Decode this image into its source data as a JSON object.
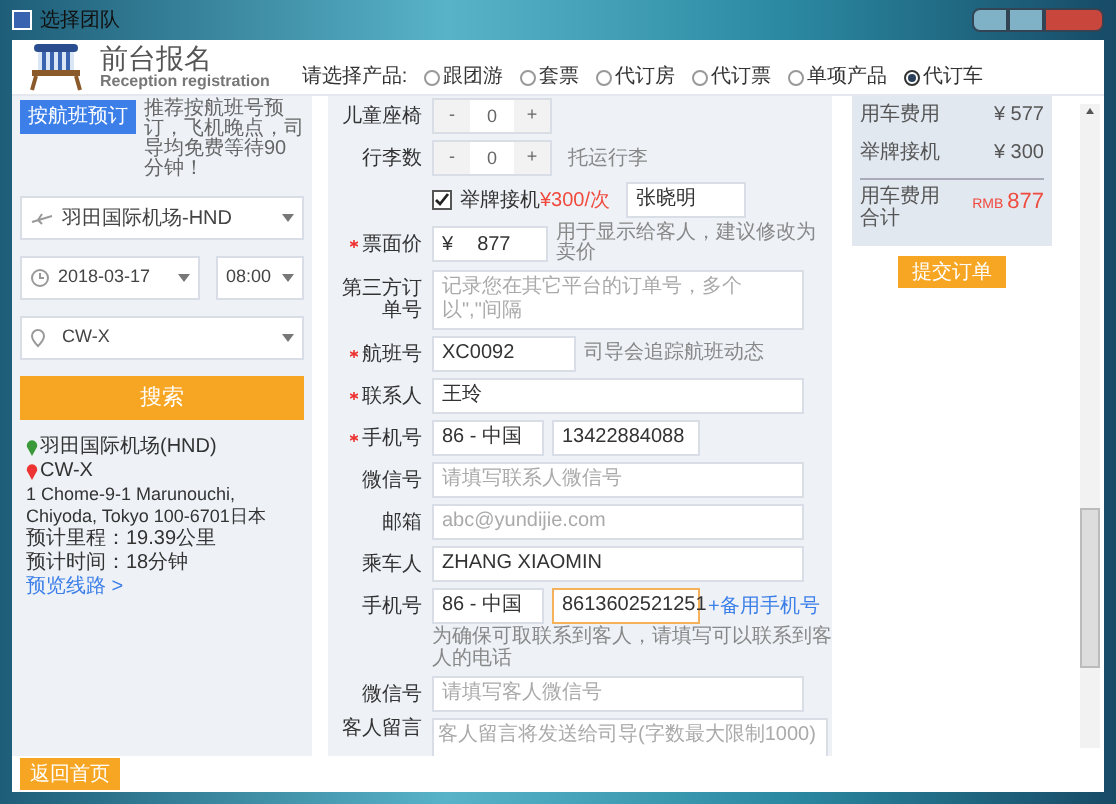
{
  "window": {
    "title": "选择团队"
  },
  "header": {
    "title": "前台报名",
    "subtitle": "Reception registration",
    "product_label": "请选择产品:",
    "products": [
      {
        "label": "跟团游",
        "selected": false
      },
      {
        "label": "套票",
        "selected": false
      },
      {
        "label": "代订房",
        "selected": false
      },
      {
        "label": "代订票",
        "selected": false
      },
      {
        "label": "单项产品",
        "selected": false
      },
      {
        "label": "代订车",
        "selected": true
      }
    ]
  },
  "left": {
    "flight_button": "按航班预订",
    "flight_note": "推荐按航班号预订，飞机晚点，司导均免费等待90分钟！",
    "airport": "羽田国际机场-HND",
    "date": "2018-03-17",
    "time": "08:00",
    "destination": "CW-X",
    "search_button": "搜索",
    "route": {
      "from": "羽田国际机场(HND)",
      "to": "CW-X",
      "address": "1 Chome-9-1 Marunouchi, Chiyoda, Tokyo 100-6701日本",
      "distance": "预计里程：19.39公里",
      "duration": "预计时间：18分钟",
      "preview_link": "预览线路 >"
    }
  },
  "form": [
    {
      "kind": "stepper",
      "label": "儿童座椅",
      "value": "0",
      "minus": "-",
      "plus": "+"
    },
    {
      "kind": "stepper",
      "label": "行李数",
      "value": "0",
      "minus": "-",
      "plus": "+",
      "hint": "托运行李"
    },
    {
      "kind": "checkbox",
      "checked": true,
      "label": "举牌接机",
      "price": "¥300/次",
      "value": "张晓明"
    },
    {
      "kind": "input",
      "label": "票面价",
      "required": true,
      "prefix": "¥",
      "value": "877",
      "hint": "用于显示给客人，建议修改为卖价"
    },
    {
      "kind": "input",
      "label": "第三方订单号",
      "required": false,
      "placeholder": "记录您在其它平台的订单号，多个以\",\"间隔"
    },
    {
      "kind": "input",
      "label": "航班号",
      "required": true,
      "value": "XC0092",
      "hint": "司导会追踪航班动态"
    },
    {
      "kind": "input",
      "label": "联系人",
      "required": true,
      "value": "王玲"
    },
    {
      "kind": "phone",
      "label": "手机号",
      "required": true,
      "code": "86 - 中国",
      "value": "13422884088",
      "focused": false
    },
    {
      "kind": "input",
      "label": "微信号",
      "required": false,
      "placeholder": "请填写联系人微信号"
    },
    {
      "kind": "input",
      "label": "邮箱",
      "required": false,
      "placeholder": "abc@yundijie.com"
    },
    {
      "kind": "input",
      "label": "乘车人",
      "required": false,
      "value": "ZHANG XIAOMIN"
    },
    {
      "kind": "phone",
      "label": "手机号",
      "required": false,
      "code": "86 - 中国",
      "value": "8613602521251",
      "focused": true,
      "link": "+备用手机号",
      "note": "为确保可取联系到客人，请填写可以联系到客人的电话"
    },
    {
      "kind": "input",
      "label": "微信号",
      "required": false,
      "placeholder": "请填写客人微信号"
    },
    {
      "kind": "textarea",
      "label": "客人留言",
      "placeholder": "客人留言将发送给司导(字数最大限制1000)"
    }
  ],
  "summary": {
    "lines": [
      {
        "label": "用车费用",
        "amount": "¥ 577"
      },
      {
        "label": "举牌接机",
        "amount": "¥ 300"
      }
    ],
    "total_label": "用车费用合计",
    "currency": "RMB",
    "total": "877",
    "submit_button": "提交订单"
  },
  "footer": {
    "back_button": "返回首页"
  }
}
